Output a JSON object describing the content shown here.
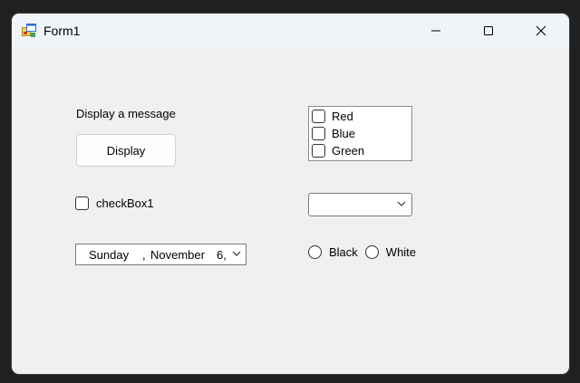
{
  "window": {
    "title": "Form1",
    "icons": {
      "app": "winforms-app-icon",
      "minimize": "minimize-icon",
      "maximize": "maximize-icon",
      "close": "close-icon"
    }
  },
  "form": {
    "label": "Display a message",
    "display_button": "Display",
    "checkbox": {
      "label": "checkBox1",
      "checked": false
    },
    "date_picker": {
      "day": "Sunday",
      "separator": ",",
      "month": "November",
      "date": "6,",
      "dropdown_icon": "chevron-down-icon"
    },
    "checked_list": {
      "items": [
        {
          "label": "Red",
          "checked": false
        },
        {
          "label": "Blue",
          "checked": false
        },
        {
          "label": "Green",
          "checked": false
        }
      ]
    },
    "combo": {
      "value": "",
      "dropdown_icon": "chevron-down-icon"
    },
    "radios": [
      {
        "label": "Black",
        "selected": false
      },
      {
        "label": "White",
        "selected": false
      }
    ]
  },
  "colors": {
    "form_background": "#f0f0f0",
    "titlebar_background": "#eff4f9",
    "frame_background": "#202020"
  }
}
